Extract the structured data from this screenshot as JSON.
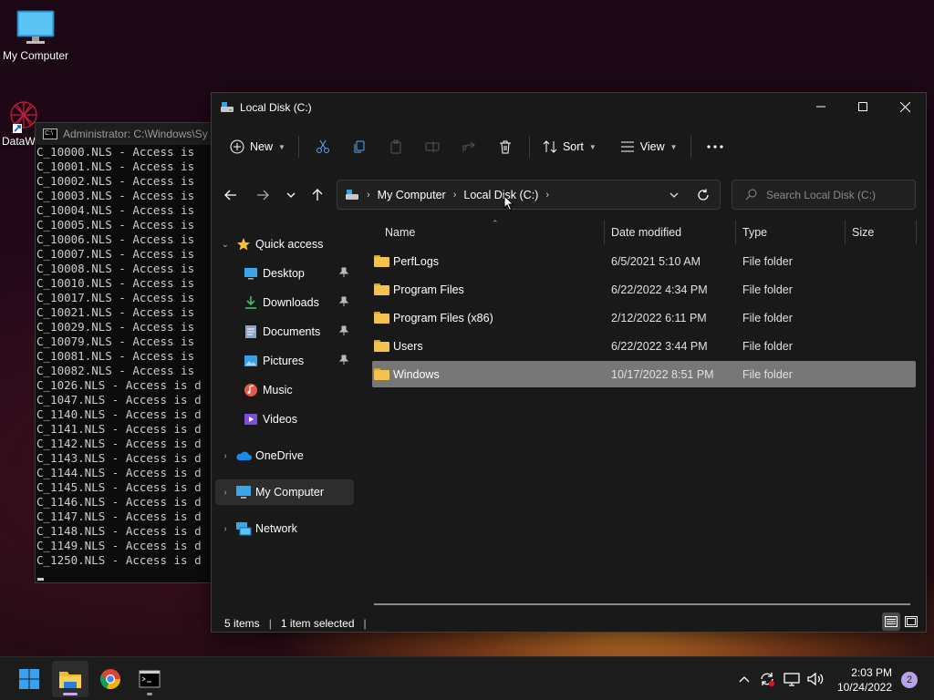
{
  "desktop": {
    "icons": [
      {
        "label": "My Computer"
      },
      {
        "label": "DataW"
      }
    ]
  },
  "cmd": {
    "title": "Administrator: C:\\Windows\\Sy",
    "lines": [
      "C_10000.NLS - Access is",
      "C_10001.NLS - Access is",
      "C_10002.NLS - Access is",
      "C_10003.NLS - Access is",
      "C_10004.NLS - Access is",
      "C_10005.NLS - Access is",
      "C_10006.NLS - Access is",
      "C_10007.NLS - Access is",
      "C_10008.NLS - Access is",
      "C_10010.NLS - Access is",
      "C_10017.NLS - Access is",
      "C_10021.NLS - Access is",
      "C_10029.NLS - Access is",
      "C_10079.NLS - Access is",
      "C_10081.NLS - Access is",
      "C_10082.NLS - Access is",
      "C_1026.NLS - Access is d",
      "C_1047.NLS - Access is d",
      "C_1140.NLS - Access is d",
      "C_1141.NLS - Access is d",
      "C_1142.NLS - Access is d",
      "C_1143.NLS - Access is d",
      "C_1144.NLS - Access is d",
      "C_1145.NLS - Access is d",
      "C_1146.NLS - Access is d",
      "C_1147.NLS - Access is d",
      "C_1148.NLS - Access is d",
      "C_1149.NLS - Access is d",
      "C_1250.NLS - Access is d"
    ]
  },
  "explorer": {
    "title": "Local Disk (C:)",
    "toolbar": {
      "new_label": "New",
      "sort_label": "Sort",
      "view_label": "View"
    },
    "address": {
      "crumbs": [
        "My Computer",
        "Local Disk (C:)"
      ]
    },
    "search": {
      "placeholder": "Search Local Disk (C:)"
    },
    "nav": {
      "quick_access": "Quick access",
      "items": [
        {
          "label": "Desktop",
          "icon": "desktop-icon",
          "pinned": true
        },
        {
          "label": "Downloads",
          "icon": "download-icon",
          "pinned": true
        },
        {
          "label": "Documents",
          "icon": "document-icon",
          "pinned": true
        },
        {
          "label": "Pictures",
          "icon": "pictures-icon",
          "pinned": true
        },
        {
          "label": "Music",
          "icon": "music-icon",
          "pinned": false
        },
        {
          "label": "Videos",
          "icon": "videos-icon",
          "pinned": false
        }
      ],
      "onedrive": "OneDrive",
      "my_computer": "My Computer",
      "network": "Network"
    },
    "columns": {
      "name": "Name",
      "date": "Date modified",
      "type": "Type",
      "size": "Size"
    },
    "files": [
      {
        "name": "PerfLogs",
        "date": "6/5/2021 5:10 AM",
        "type": "File folder",
        "selected": false
      },
      {
        "name": "Program Files",
        "date": "6/22/2022 4:34 PM",
        "type": "File folder",
        "selected": false
      },
      {
        "name": "Program Files (x86)",
        "date": "2/12/2022 6:11 PM",
        "type": "File folder",
        "selected": false
      },
      {
        "name": "Users",
        "date": "6/22/2022 3:44 PM",
        "type": "File folder",
        "selected": false
      },
      {
        "name": "Windows",
        "date": "10/17/2022 8:51 PM",
        "type": "File folder",
        "selected": true
      }
    ],
    "status": {
      "items": "5 items",
      "selected": "1 item selected"
    }
  },
  "taskbar": {
    "time": "2:03 PM",
    "date": "10/24/2022",
    "notifications": "2"
  },
  "colors": {
    "folder": "#f2c350",
    "selection": "#777777",
    "accent_indicator": "#c8a8e8"
  }
}
